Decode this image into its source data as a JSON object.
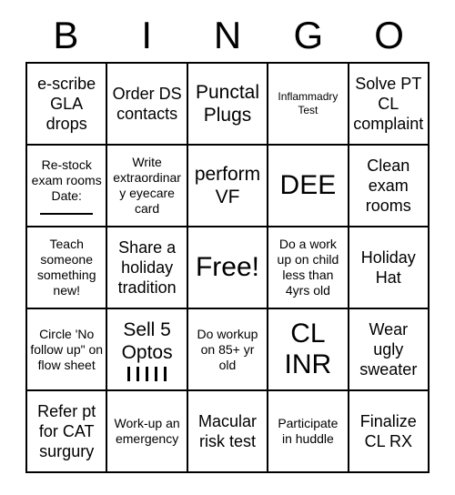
{
  "header": {
    "letters": [
      "B",
      "I",
      "N",
      "G",
      "O"
    ]
  },
  "grid": {
    "rows": [
      [
        {
          "text": "e-scribe GLA drops",
          "size": "md"
        },
        {
          "text": "Order DS contacts",
          "size": "md"
        },
        {
          "text": "Punctal Plugs",
          "size": "lg"
        },
        {
          "text": "Inflammadry Test",
          "size": "xs"
        },
        {
          "text": "Solve PT CL complaint",
          "size": "md"
        }
      ],
      [
        {
          "text": "Re-stock exam rooms Date:",
          "size": "sm",
          "extra": "date-rule"
        },
        {
          "text": "Write extraordinary eyecare card",
          "size": "sm"
        },
        {
          "text": "perform VF",
          "size": "lg"
        },
        {
          "text": "DEE",
          "size": "xl"
        },
        {
          "text": "Clean exam rooms",
          "size": "md"
        }
      ],
      [
        {
          "text": "Teach someone something new!",
          "size": "sm"
        },
        {
          "text": "Share a holiday tradition",
          "size": "md"
        },
        {
          "text": "Free!",
          "size": "xl"
        },
        {
          "text": "Do a work up on child less than 4yrs old",
          "size": "sm"
        },
        {
          "text": "Holiday Hat",
          "size": "md"
        }
      ],
      [
        {
          "text": "Circle 'No follow up\" on flow sheet",
          "size": "sm"
        },
        {
          "text": "Sell 5 Optos",
          "size": "lg",
          "extra": "tallies",
          "tally_count": 5
        },
        {
          "text": "Do workup on 85+ yr old",
          "size": "sm"
        },
        {
          "text": "CL INR",
          "size": "xl"
        },
        {
          "text": "Wear ugly sweater",
          "size": "md"
        }
      ],
      [
        {
          "text": "Refer pt for CAT surgury",
          "size": "md"
        },
        {
          "text": "Work-up an emergency",
          "size": "sm"
        },
        {
          "text": "Macular risk test",
          "size": "md"
        },
        {
          "text": "Participate in huddle",
          "size": "sm"
        },
        {
          "text": "Finalize CL RX",
          "size": "md"
        }
      ]
    ]
  },
  "colors": {
    "background": "#ffffff",
    "text": "#000000",
    "border": "#000000"
  }
}
